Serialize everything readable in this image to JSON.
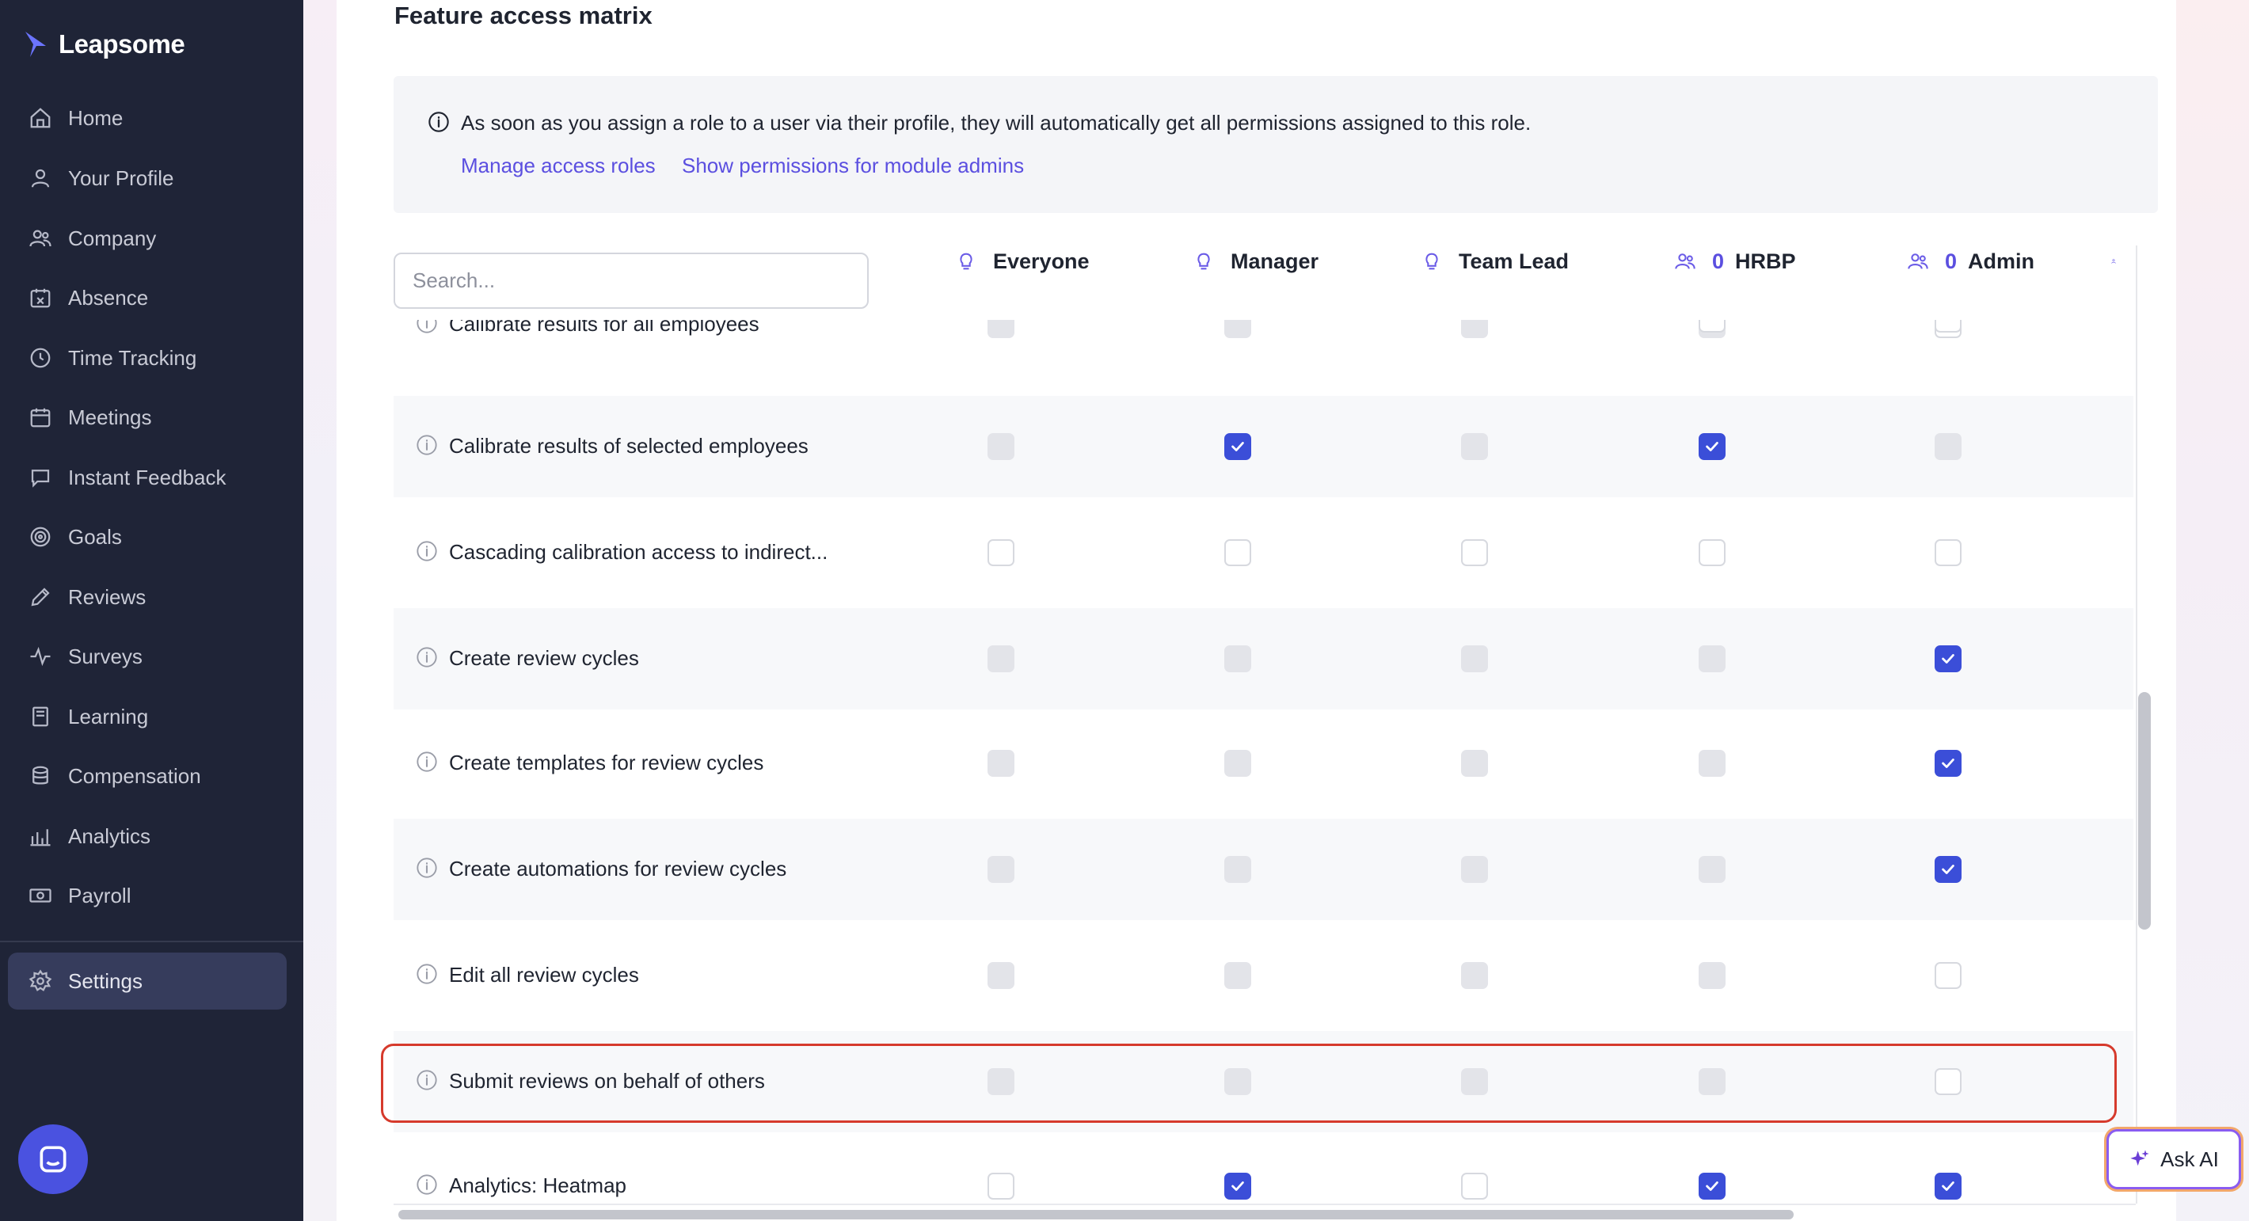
{
  "app": {
    "logo_text": "Leapsome"
  },
  "sidebar": {
    "items": [
      {
        "label": "Home",
        "icon": "home-icon"
      },
      {
        "label": "Your Profile",
        "icon": "user-icon"
      },
      {
        "label": "Company",
        "icon": "users-icon"
      },
      {
        "label": "Absence",
        "icon": "calendar-x-icon"
      },
      {
        "label": "Time Tracking",
        "icon": "clock-icon"
      },
      {
        "label": "Meetings",
        "icon": "calendar-icon"
      },
      {
        "label": "Instant Feedback",
        "icon": "chat-bubble-icon"
      },
      {
        "label": "Goals",
        "icon": "target-icon"
      },
      {
        "label": "Reviews",
        "icon": "pencil-icon"
      },
      {
        "label": "Surveys",
        "icon": "pulse-icon"
      },
      {
        "label": "Learning",
        "icon": "book-icon"
      },
      {
        "label": "Compensation",
        "icon": "coins-icon"
      },
      {
        "label": "Analytics",
        "icon": "bar-chart-icon"
      },
      {
        "label": "Payroll",
        "icon": "banknote-icon"
      }
    ],
    "settings_label": "Settings"
  },
  "page": {
    "title": "Feature access matrix",
    "info_text": "As soon as you assign a role to a user via their profile, they will automatically get all permissions assigned to this role.",
    "link_manage_roles": "Manage access roles",
    "link_module_admins": "Show permissions for module admins",
    "search_placeholder": "Search..."
  },
  "columns": [
    {
      "name": "Everyone",
      "icon": "lightbulb-icon",
      "count": ""
    },
    {
      "name": "Manager",
      "icon": "lightbulb-icon",
      "count": ""
    },
    {
      "name": "Team Lead",
      "icon": "lightbulb-icon",
      "count": ""
    },
    {
      "name": "HRBP",
      "icon": "users-icon",
      "count": "0"
    },
    {
      "name": "Admin",
      "icon": "users-icon",
      "count": "0"
    }
  ],
  "rows": [
    {
      "label": "Calibrate results for all employees",
      "cells": [
        "off",
        "off",
        "off",
        "off",
        "empty"
      ]
    },
    {
      "label": "Calibrate results of selected employees",
      "cells": [
        "off",
        "on",
        "off",
        "on",
        "off"
      ]
    },
    {
      "label": "Cascading calibration access to indirect...",
      "cells": [
        "empty",
        "empty",
        "empty",
        "empty",
        "empty"
      ]
    },
    {
      "label": "Create review cycles",
      "cells": [
        "off",
        "off",
        "off",
        "off",
        "on"
      ]
    },
    {
      "label": "Create templates for review cycles",
      "cells": [
        "off",
        "off",
        "off",
        "off",
        "on"
      ]
    },
    {
      "label": "Create automations for review cycles",
      "cells": [
        "off",
        "off",
        "off",
        "off",
        "on"
      ]
    },
    {
      "label": "Edit all review cycles",
      "cells": [
        "off",
        "off",
        "off",
        "off",
        "empty"
      ]
    },
    {
      "label": "Submit reviews on behalf of others",
      "cells": [
        "off",
        "off",
        "off",
        "off",
        "empty"
      ]
    },
    {
      "label": "Analytics: Heatmap",
      "cells": [
        "empty",
        "on",
        "empty",
        "on",
        "on"
      ]
    }
  ],
  "ask_ai": {
    "label": "Ask AI"
  }
}
